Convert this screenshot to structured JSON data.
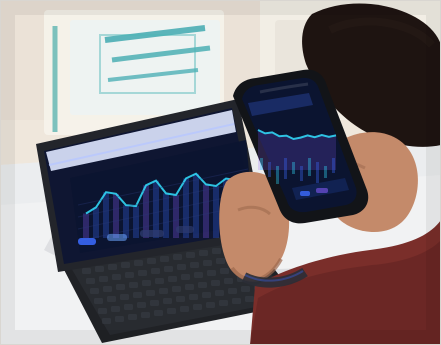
{
  "palette": {
    "wall": "#efe7dc",
    "wall_shadow": "#e2d6c8",
    "table": "#f1f2f3",
    "tablet_body": "#23252b",
    "tablet_screen": "#0f1632",
    "chart_cyan": "#33e0ff",
    "chart_blue": "#3c6bff",
    "chart_violet": "#8c5cff",
    "phone_body": "#121418",
    "phone_screen": "#0b1430",
    "skin": "#c48a6a",
    "skin_shadow": "#9e6a4f",
    "sweater": "#7a2e2a",
    "hair": "#1e1411",
    "keyboard": "#202226",
    "poster_teal": "#3aa6a4"
  },
  "scene": {
    "tablet_chart_series": [
      0.35,
      0.42,
      0.62,
      0.58,
      0.4,
      0.37,
      0.65,
      0.7,
      0.5,
      0.46,
      0.68,
      0.73,
      0.56,
      0.52,
      0.61,
      0.57
    ],
    "phone_chart_series": [
      0.55,
      0.48,
      0.52,
      0.44,
      0.47,
      0.4,
      0.45,
      0.52,
      0.49,
      0.56,
      0.53,
      0.58
    ]
  }
}
